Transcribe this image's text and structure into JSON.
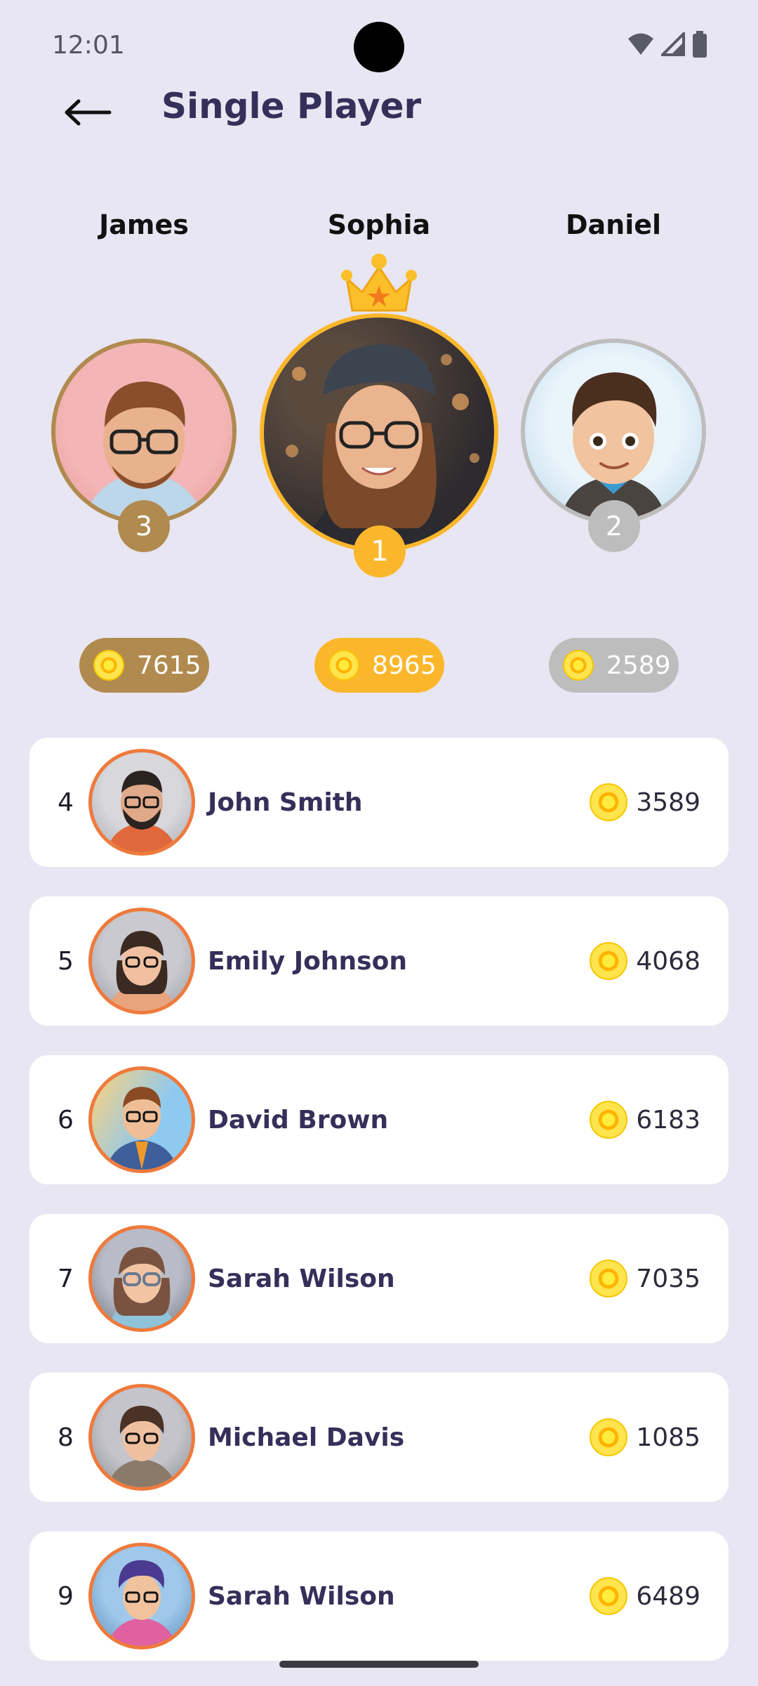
{
  "status_bar": {
    "time": "12:01"
  },
  "app_bar": {
    "title": "Single Player"
  },
  "podium": [
    {
      "rank": "3",
      "name": "James",
      "score": "7615",
      "color": "#b08a4e"
    },
    {
      "rank": "1",
      "name": "Sophia",
      "score": "8965",
      "color": "#fbb72c"
    },
    {
      "rank": "2",
      "name": "Daniel",
      "score": "2589",
      "color": "#bdbdbd"
    }
  ],
  "leaderboard": [
    {
      "rank": "4",
      "name": "John Smith",
      "score": "3589"
    },
    {
      "rank": "5",
      "name": "Emily Johnson",
      "score": "4068"
    },
    {
      "rank": "6",
      "name": "David Brown",
      "score": "6183"
    },
    {
      "rank": "7",
      "name": "Sarah Wilson",
      "score": "7035"
    },
    {
      "rank": "8",
      "name": "Michael Davis",
      "score": "1085"
    },
    {
      "rank": "9",
      "name": "Sarah Wilson",
      "score": "6489"
    }
  ],
  "colors": {
    "background": "#e8e6f2",
    "accent_orange": "#ef7a3c",
    "gold": "#fbb72c",
    "bronze": "#b08a4e",
    "silver": "#bdbdbd",
    "title": "#35305a"
  },
  "icons": {
    "back": "arrow-left-icon",
    "coin": "coin-icon",
    "crown": "crown-icon",
    "wifi": "wifi-icon",
    "signal": "signal-icon",
    "battery": "battery-icon"
  }
}
